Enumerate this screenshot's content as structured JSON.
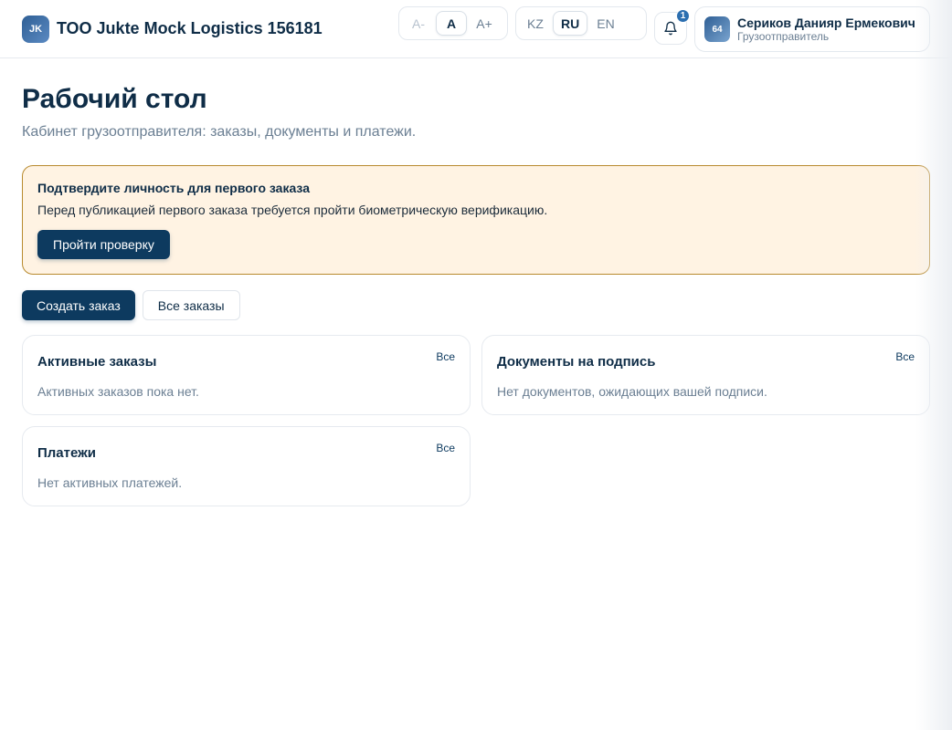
{
  "header": {
    "logo_initials": "JK",
    "company_name": "ТОО Jukte Mock Logistics 156181",
    "font_size": {
      "decrease": "A-",
      "normal": "A",
      "increase": "A+"
    },
    "languages": [
      "KZ",
      "RU",
      "EN"
    ],
    "active_language": "RU",
    "notifications_count": "1",
    "user": {
      "avatar_text": "64",
      "name": "Сериков Данияр Ермекович",
      "role": "Грузоотправитель"
    }
  },
  "page": {
    "title": "Рабочий стол",
    "subtitle": "Кабинет грузоотправителя: заказы, документы и платежи."
  },
  "alert": {
    "title": "Подтвердите личность для первого заказа",
    "text": "Перед публикацией первого заказа требуется пройти биометрическую верификацию.",
    "button": "Пройти проверку"
  },
  "actions": {
    "create": "Создать заказ",
    "all": "Все заказы"
  },
  "cards": [
    {
      "title": "Активные заказы",
      "link": "Все",
      "empty": "Активных заказов пока нет."
    },
    {
      "title": "Документы на подпись",
      "link": "Все",
      "empty": "Нет документов, ожидающих вашей подписи."
    },
    {
      "title": "Платежи",
      "link": "Все",
      "empty": "Нет активных платежей."
    }
  ],
  "colors": {
    "primary": "#0d3a5f",
    "alert_bg": "#fff3e3",
    "alert_border": "#b88a2e",
    "muted": "#6b7f93"
  }
}
